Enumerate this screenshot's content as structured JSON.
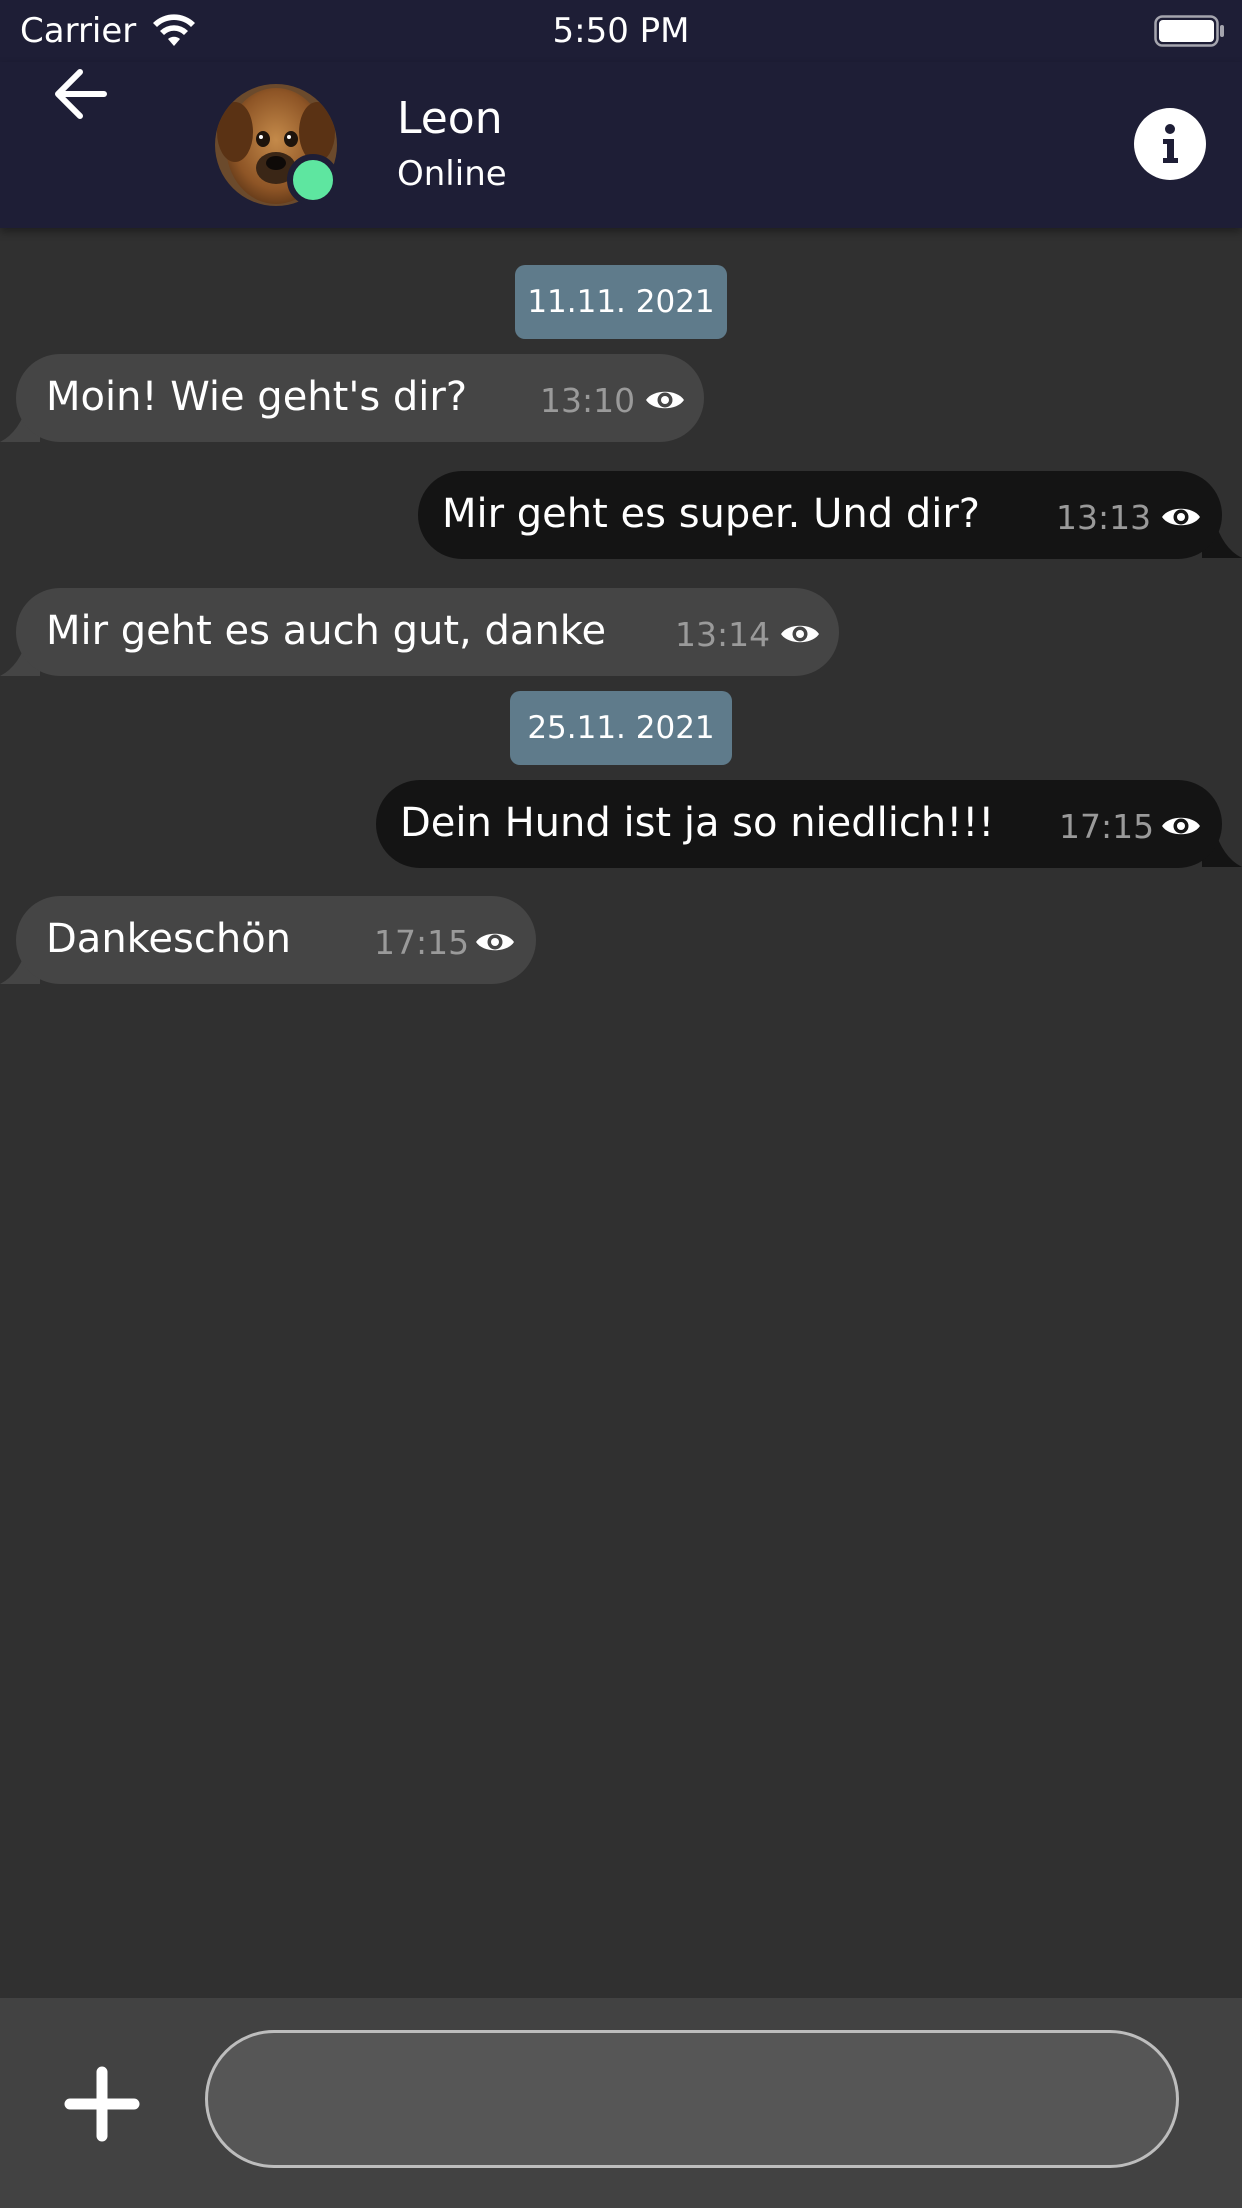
{
  "status_bar": {
    "carrier": "Carrier",
    "time": "5:50 PM",
    "wifi_icon": "wifi-icon",
    "battery_icon": "battery-icon"
  },
  "header": {
    "back_icon": "arrow-left-icon",
    "contact_name": "Leon",
    "contact_status": "Online",
    "info_icon": "info-icon",
    "online_indicator_color": "#5ee6a0",
    "bar_color": "#1e1e36"
  },
  "chat": {
    "date_separators": [
      "11.11. 2021",
      "25.11. 2021"
    ],
    "messages": [
      {
        "direction": "incoming",
        "text": "Moin! Wie geht's dir?",
        "time": "13:10",
        "status_icon": "eye-icon"
      },
      {
        "direction": "outgoing",
        "text": "Mir geht es super. Und dir?",
        "time": "13:13",
        "status_icon": "eye-icon"
      },
      {
        "direction": "incoming",
        "text": "Mir geht es auch gut, danke",
        "time": "13:14",
        "status_icon": "eye-icon"
      },
      {
        "direction": "outgoing",
        "text": "Dein Hund ist ja so niedlich!!!",
        "time": "17:15",
        "status_icon": "eye-icon"
      },
      {
        "direction": "incoming",
        "text": "Dankeschön",
        "time": "17:15",
        "status_icon": "eye-icon"
      }
    ],
    "colors": {
      "background": "#303030",
      "incoming_bubble": "#454545",
      "outgoing_bubble": "#141414",
      "date_chip": "#5f7b8b"
    }
  },
  "composer": {
    "add_icon": "plus-icon",
    "input_value": "",
    "input_placeholder": ""
  }
}
